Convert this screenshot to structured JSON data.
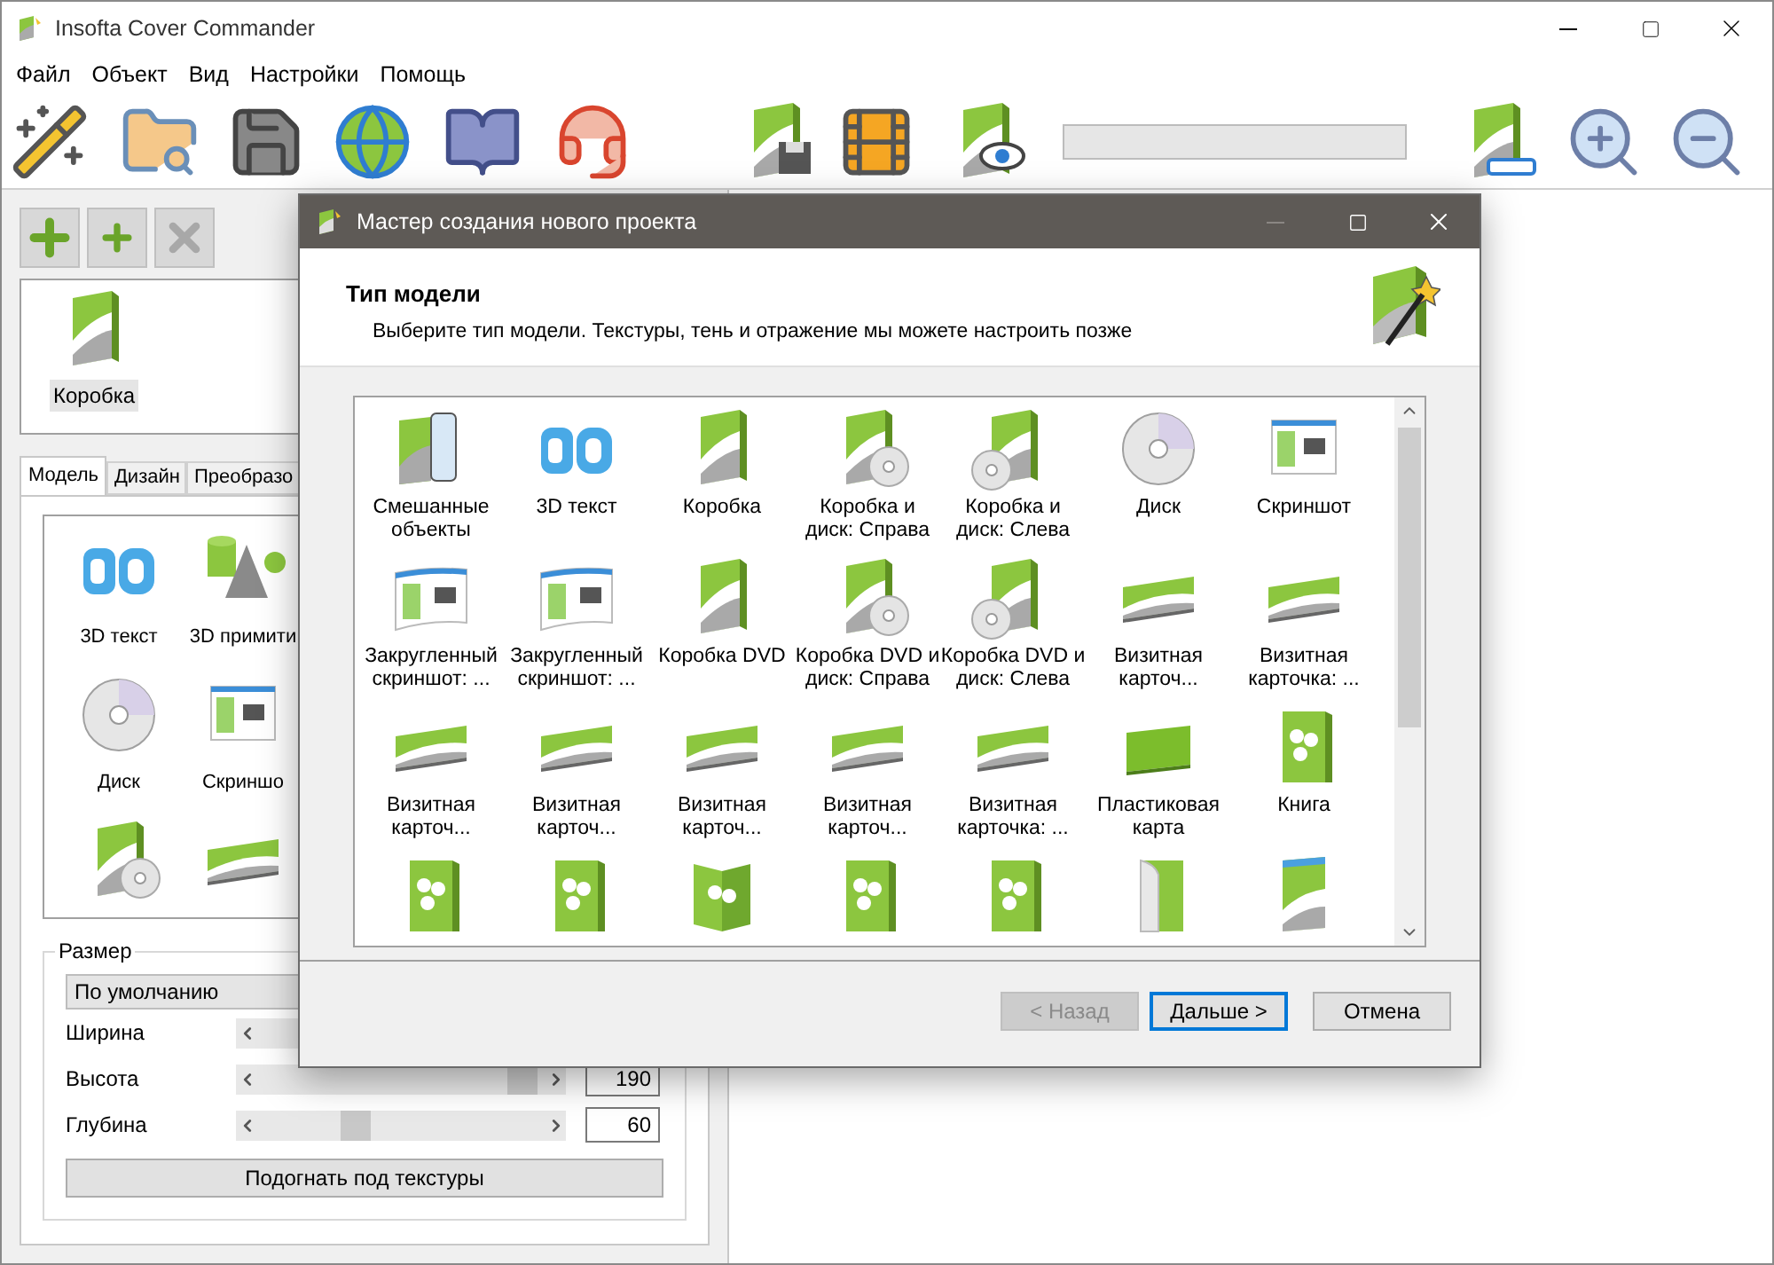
{
  "window": {
    "title": "Insofta Cover Commander"
  },
  "menu": [
    "Файл",
    "Объект",
    "Вид",
    "Настройки",
    "Помощь"
  ],
  "project_buttons": [
    {
      "kind": "add",
      "disabled": false
    },
    {
      "kind": "add_copy",
      "disabled": false
    },
    {
      "kind": "delete",
      "disabled": true
    }
  ],
  "objects": [
    {
      "label": "Коробка",
      "selected": true
    }
  ],
  "tabs": [
    {
      "label": "Модель",
      "selected": true
    },
    {
      "label": "Дизайн",
      "selected": false
    },
    {
      "label": "Преобразо",
      "selected": false
    }
  ],
  "models": [
    {
      "label": "3D текст",
      "kind": "text3d"
    },
    {
      "label": "3D примити",
      "kind": "primitives"
    },
    {
      "label": "Диск",
      "kind": "disc"
    },
    {
      "label": "Скриншо",
      "kind": "screenshot"
    },
    {
      "kind": "dvd_disc_right"
    },
    {
      "kind": "card"
    }
  ],
  "size": {
    "title": "Размер",
    "preset": "По умолчанию",
    "rows": [
      {
        "label": "Ширина"
      },
      {
        "label": "Высота",
        "level": 0.92,
        "value": "190"
      },
      {
        "label": "Глубина",
        "level": 0.34,
        "value": "60"
      }
    ],
    "fit_button": "Подогнать под текстуры"
  },
  "dialog": {
    "title": "Мастер создания нового проекта",
    "heading": "Тип модели",
    "subtitle": "Выберите тип модели. Текстуры, тень и отражение мы можете настроить позже",
    "items": [
      {
        "label": "Смешанные объекты",
        "kind": "mixed"
      },
      {
        "label": "3D текст",
        "kind": "text3d"
      },
      {
        "label": "Коробка",
        "kind": "box"
      },
      {
        "label": "Коробка и диск: Справа",
        "kind": "box_disc_right"
      },
      {
        "label": "Коробка и диск: Слева",
        "kind": "box_disc_left"
      },
      {
        "label": "Диск",
        "kind": "disc"
      },
      {
        "label": "Скриншот",
        "kind": "screenshot"
      },
      {
        "label": "Закругленный скриншот: ...",
        "kind": "curved_screenshot"
      },
      {
        "label": "Закругленный скриншот: ...",
        "kind": "curved_screenshot"
      },
      {
        "label": "Коробка DVD",
        "kind": "dvd"
      },
      {
        "label": "Коробка DVD и диск: Справа",
        "kind": "dvd_disc_right"
      },
      {
        "label": "Коробка DVD и диск: Слева",
        "kind": "dvd_disc_left"
      },
      {
        "label": "Визитная карточ...",
        "kind": "card"
      },
      {
        "label": "Визитная карточка: ...",
        "kind": "card"
      },
      {
        "label": "Визитная карточ...",
        "kind": "card"
      },
      {
        "label": "Визитная карточ...",
        "kind": "card"
      },
      {
        "label": "Визитная карточ...",
        "kind": "card"
      },
      {
        "label": "Визитная карточ...",
        "kind": "card"
      },
      {
        "label": "Визитная карточка: ...",
        "kind": "card"
      },
      {
        "label": "Пластиковая карта",
        "kind": "plastic_card"
      },
      {
        "label": "Книга",
        "kind": "book"
      },
      {
        "kind": "book"
      },
      {
        "kind": "book"
      },
      {
        "kind": "booklet"
      },
      {
        "kind": "book"
      },
      {
        "kind": "book"
      },
      {
        "kind": "vista"
      },
      {
        "kind": "bluray"
      }
    ],
    "buttons": [
      {
        "label": "< Назад",
        "disabled": true,
        "default": false
      },
      {
        "label": "Дальше >",
        "disabled": false,
        "default": true
      },
      {
        "label": "Отмена",
        "disabled": false,
        "default": false
      }
    ]
  }
}
